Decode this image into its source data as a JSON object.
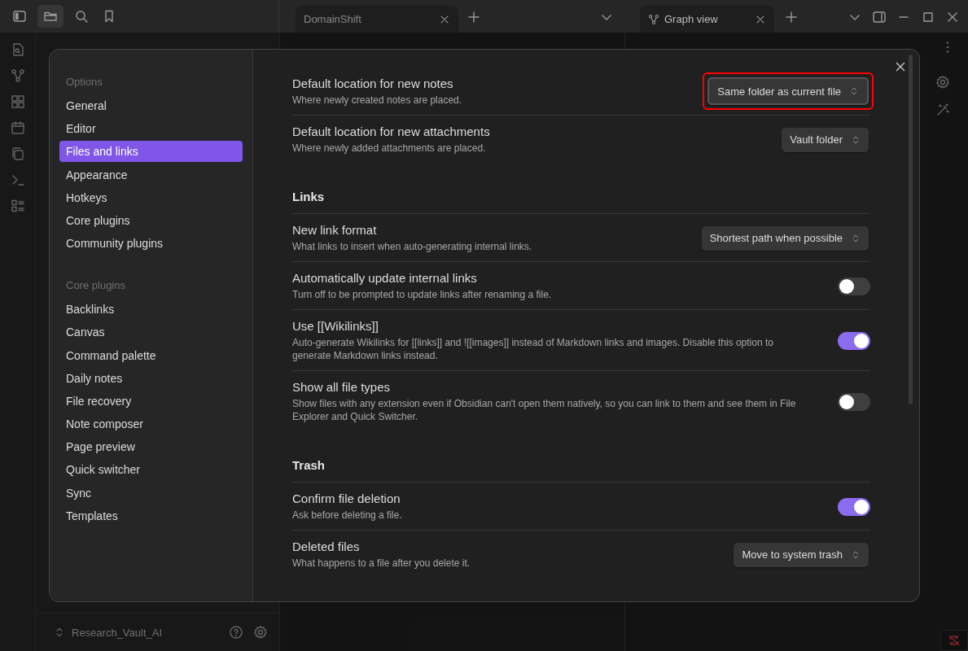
{
  "panes": [
    {
      "tab": {
        "label": "DomainShift",
        "icon": false
      }
    },
    {
      "tab": {
        "label": "Graph view",
        "icon": true
      }
    }
  ],
  "vault": {
    "name": "Research_Vault_AI"
  },
  "settings": {
    "nav": [
      {
        "heading": "Options",
        "items": [
          {
            "label": "General",
            "selected": false
          },
          {
            "label": "Editor",
            "selected": false
          },
          {
            "label": "Files and links",
            "selected": true
          },
          {
            "label": "Appearance",
            "selected": false
          },
          {
            "label": "Hotkeys",
            "selected": false
          },
          {
            "label": "Core plugins",
            "selected": false
          },
          {
            "label": "Community plugins",
            "selected": false
          }
        ]
      },
      {
        "heading": "Core plugins",
        "items": [
          {
            "label": "Backlinks",
            "selected": false
          },
          {
            "label": "Canvas",
            "selected": false
          },
          {
            "label": "Command palette",
            "selected": false
          },
          {
            "label": "Daily notes",
            "selected": false
          },
          {
            "label": "File recovery",
            "selected": false
          },
          {
            "label": "Note composer",
            "selected": false
          },
          {
            "label": "Page preview",
            "selected": false
          },
          {
            "label": "Quick switcher",
            "selected": false
          },
          {
            "label": "Sync",
            "selected": false
          },
          {
            "label": "Templates",
            "selected": false
          }
        ]
      }
    ],
    "items": [
      {
        "kind": "dropdown",
        "name": "Default location for new notes",
        "description": "Where newly created notes are placed.",
        "value": "Same folder as current file",
        "highlighted": true
      },
      {
        "kind": "dropdown",
        "name": "Default location for new attachments",
        "description": "Where newly added attachments are placed.",
        "value": "Vault folder",
        "highlighted": false
      },
      {
        "kind": "heading",
        "name": "Links"
      },
      {
        "kind": "dropdown",
        "name": "New link format",
        "description": "What links to insert when auto-generating internal links.",
        "value": "Shortest path when possible",
        "highlighted": false
      },
      {
        "kind": "toggle",
        "name": "Automatically update internal links",
        "description": "Turn off to be prompted to update links after renaming a file.",
        "on": false
      },
      {
        "kind": "toggle",
        "name": "Use [[Wikilinks]]",
        "description": "Auto-generate Wikilinks for [[links]] and ![[images]] instead of Markdown links and images. Disable this option to generate Markdown links instead.",
        "on": true
      },
      {
        "kind": "toggle",
        "name": "Show all file types",
        "description": "Show files with any extension even if Obsidian can't open them natively, so you can link to them and see them in File Explorer and Quick Switcher.",
        "on": false
      },
      {
        "kind": "heading",
        "name": "Trash"
      },
      {
        "kind": "toggle",
        "name": "Confirm file deletion",
        "description": "Ask before deleting a file.",
        "on": true
      },
      {
        "kind": "dropdown",
        "name": "Deleted files",
        "description": "What happens to a file after you delete it.",
        "value": "Move to system trash",
        "highlighted": false
      }
    ]
  }
}
